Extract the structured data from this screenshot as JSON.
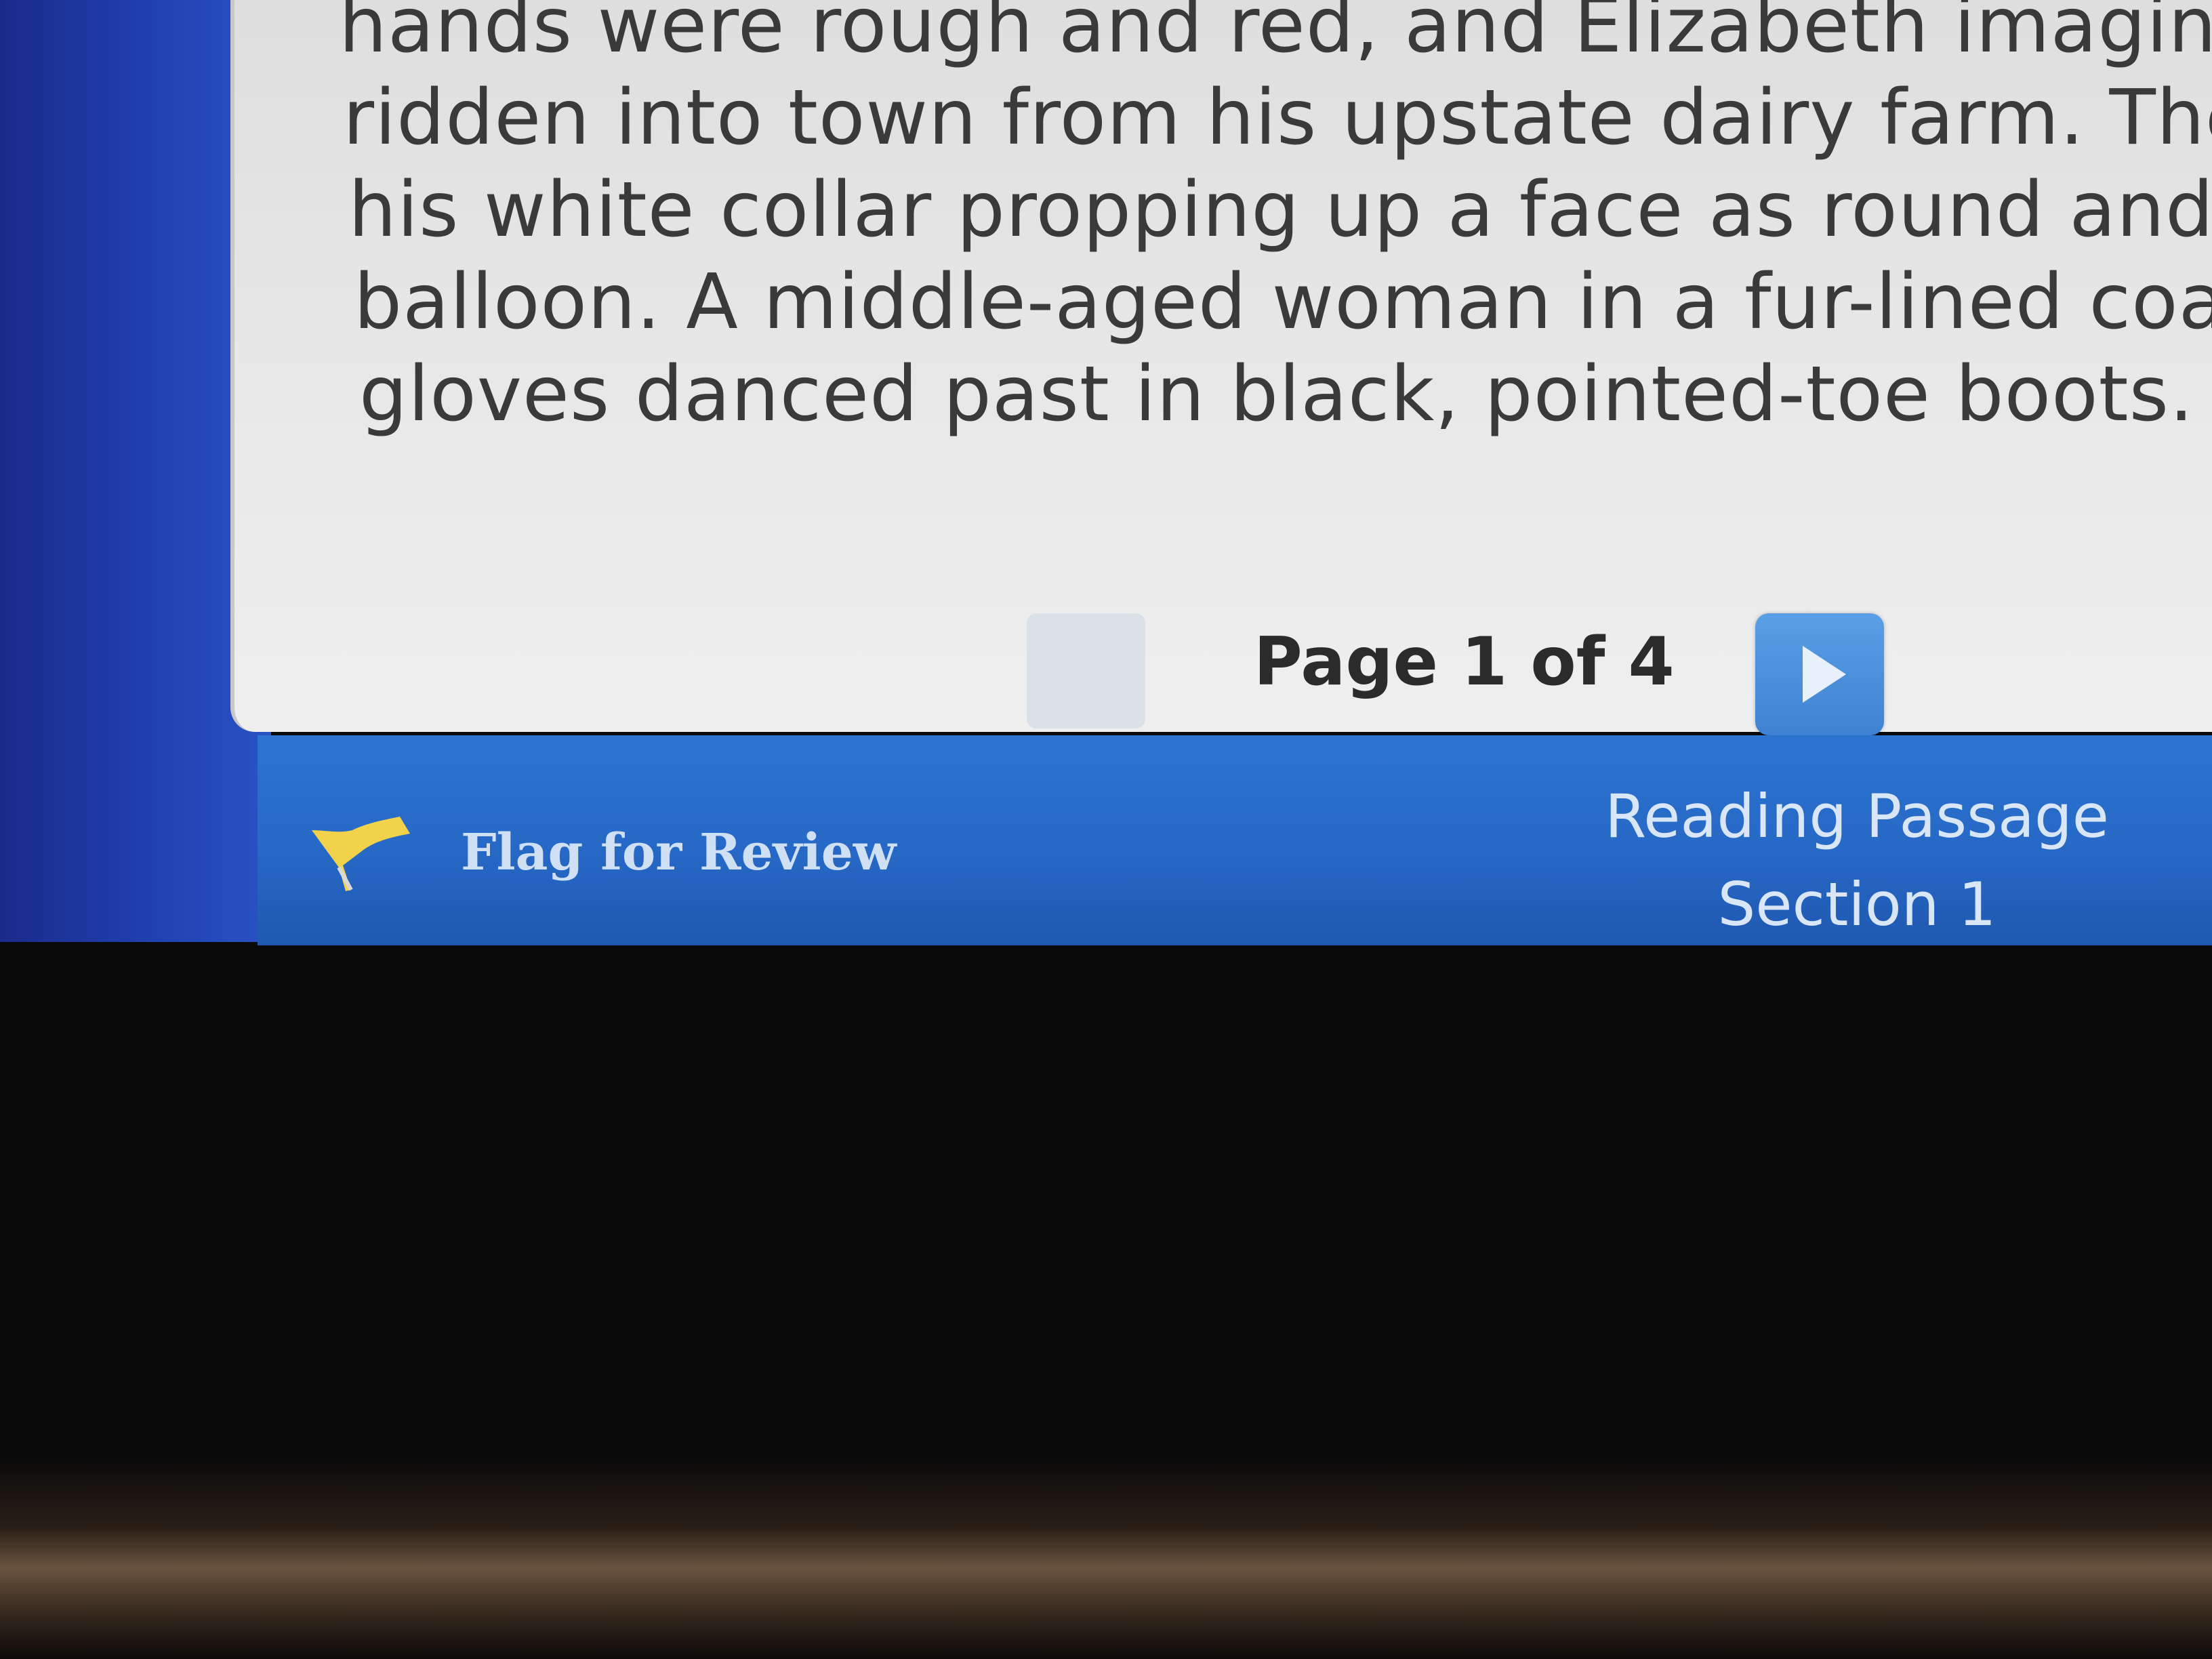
{
  "passage": {
    "lines": [
      "hands were rough and red, and Elizabeth imagined tha",
      "ridden into town from his upstate dairy farm. There wa",
      "his white collar propping up a face as round and red as",
      "balloon. A middle-aged woman in a fur-lined coat and m",
      "gloves danced past in black, pointed-toe boots."
    ]
  },
  "pager": {
    "indicator": "Page 1 of 4",
    "prev_icon": "play-left-icon",
    "next_icon": "play-right-icon"
  },
  "footer": {
    "flag_label": "Flag for Review",
    "flag_icon": "flag-icon",
    "section_title": "Reading Passage",
    "section_name": "Section 1"
  },
  "colors": {
    "accent_blue": "#2c74d0",
    "flag_yellow": "#f2d24a",
    "panel_bg": "#e9e9e9"
  }
}
